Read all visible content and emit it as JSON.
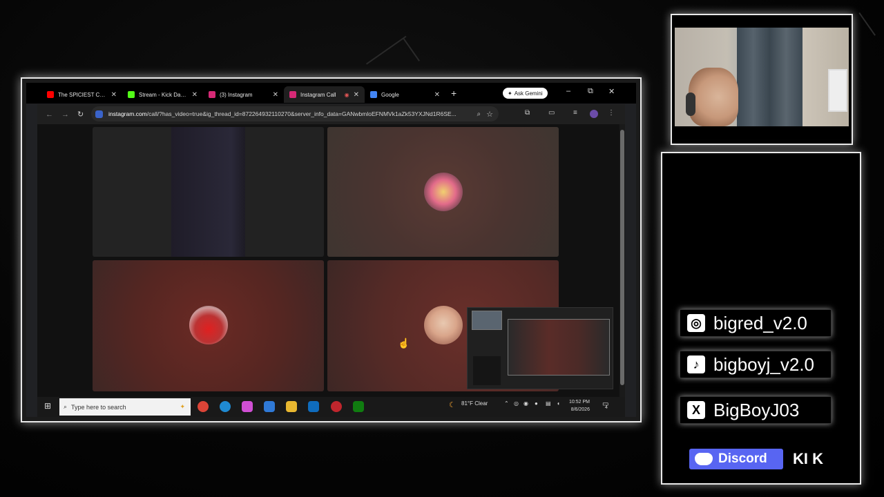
{
  "browser": {
    "tabs": [
      {
        "title": "The SPICIEST Chicken",
        "icon": "youtube-icon",
        "color": "#ff0000",
        "active": false
      },
      {
        "title": "Stream - Kick Dashbo",
        "icon": "kick-icon",
        "color": "#53fc18",
        "active": false
      },
      {
        "title": "(3) Instagram",
        "icon": "instagram-icon",
        "color": "#d62976",
        "active": false
      },
      {
        "title": "Instagram Call",
        "icon": "instagram-icon",
        "color": "#d62976",
        "active": true
      },
      {
        "title": "Google",
        "icon": "google-icon",
        "color": "#4285f4",
        "active": false
      }
    ],
    "new_tab": "+",
    "ask_gemini": "Ask Gemini",
    "url_host": "instagram.com",
    "url_rest": "/call/?has_video=true&ig_thread_id=872264932110270&server_info_data=GANwbmloEFNMVk1aZk53YXJNd1R6SE...",
    "window_controls": {
      "minimize": "–",
      "restore": "⧉",
      "close": "✕"
    }
  },
  "taskbar": {
    "search_placeholder": "Type here to search",
    "weather": "81°F  Clear",
    "time": "10:52 PM",
    "date": "8/6/2026",
    "notification_count": "4"
  },
  "call": {
    "participants": 4
  },
  "socials": {
    "instagram": "bigred_v2.0",
    "tiktok": "bigboyj_v2.0",
    "x": "BigBoyJ03",
    "discord": "Discord",
    "kick": "KI K"
  },
  "colors": {
    "discord": "#5865F2",
    "accent_glow": "#e9e9e9"
  }
}
